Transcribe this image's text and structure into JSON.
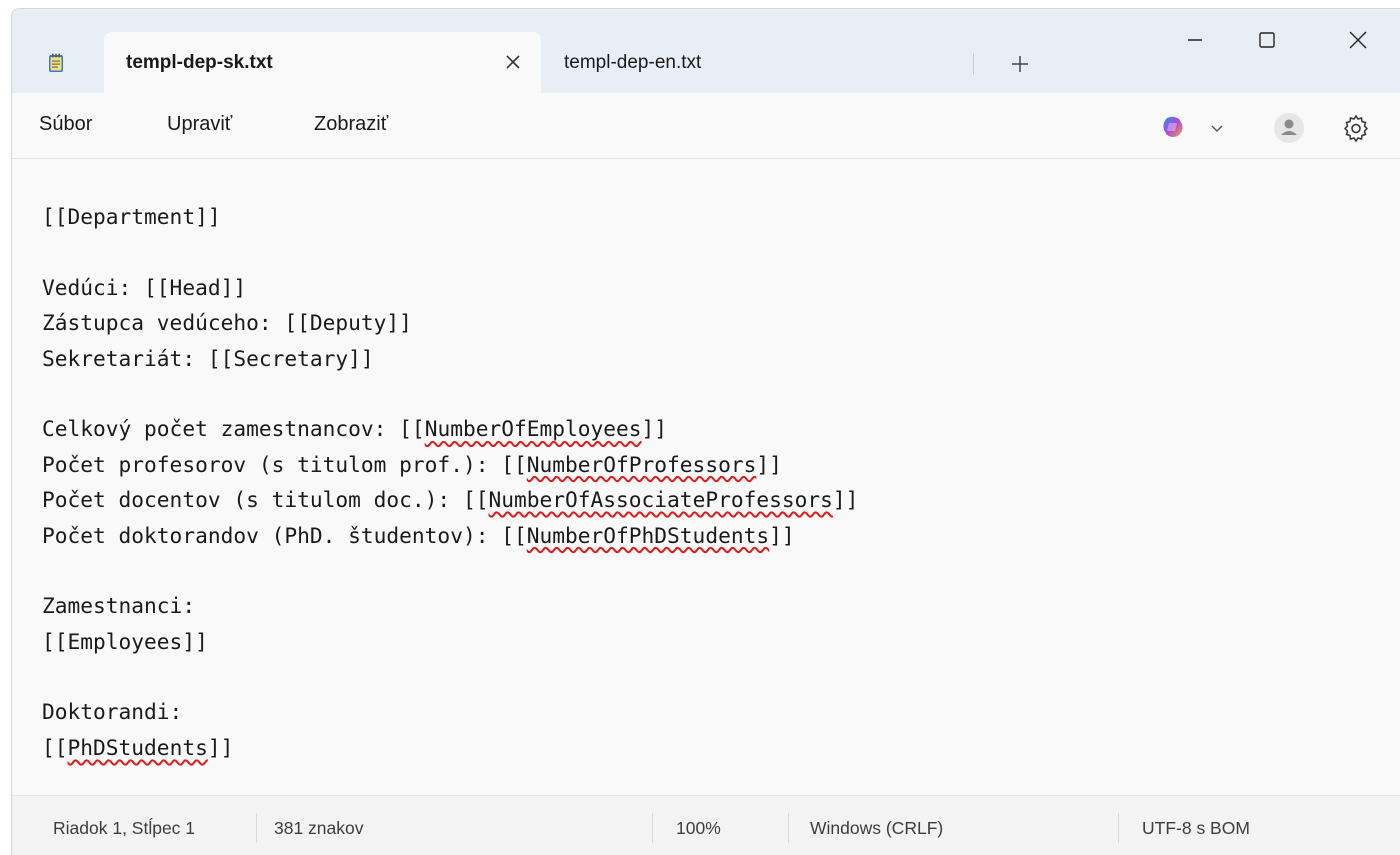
{
  "tabs": [
    {
      "label": "templ-dep-sk.txt",
      "active": true
    },
    {
      "label": "templ-dep-en.txt",
      "active": false
    }
  ],
  "menu": {
    "items": [
      "Súbor",
      "Upraviť",
      "Zobraziť"
    ]
  },
  "editor": {
    "lines": [
      [
        {
          "t": "[[Department]]"
        }
      ],
      [],
      [
        {
          "t": "Vedúci: [[Head]]"
        }
      ],
      [
        {
          "t": "Zástupca vedúceho: [[Deputy]]"
        }
      ],
      [
        {
          "t": "Sekretariát: [[Secretary]]"
        }
      ],
      [],
      [
        {
          "t": "Celkový počet zamestnancov: [["
        },
        {
          "t": "NumberOfEmployees",
          "s": true
        },
        {
          "t": "]]"
        }
      ],
      [
        {
          "t": "Počet profesorov (s titulom prof.): [["
        },
        {
          "t": "NumberOfProfessors",
          "s": true
        },
        {
          "t": "]]"
        }
      ],
      [
        {
          "t": "Počet docentov (s titulom doc.): [["
        },
        {
          "t": "NumberOfAssociateProfessors",
          "s": true
        },
        {
          "t": "]]"
        }
      ],
      [
        {
          "t": "Počet doktorandov (PhD. študentov): [["
        },
        {
          "t": "NumberOfPhDStudents",
          "s": true
        },
        {
          "t": "]]"
        }
      ],
      [],
      [
        {
          "t": "Zamestnanci:"
        }
      ],
      [
        {
          "t": "[[Employees]]"
        }
      ],
      [],
      [
        {
          "t": "Doktorandi:"
        }
      ],
      [
        {
          "t": "[["
        },
        {
          "t": "PhDStudents",
          "s": true
        },
        {
          "t": "]]"
        }
      ]
    ]
  },
  "status": {
    "position": "Riadok 1, Stĺpec 1",
    "chars": "381 znakov",
    "zoom": "100%",
    "line_ending": "Windows (CRLF)",
    "encoding": "UTF-8 s BOM"
  },
  "icons": {
    "app": "notepad-icon",
    "close_tab": "close-icon",
    "new_tab": "plus-icon",
    "minimize": "minimize-icon",
    "maximize": "maximize-icon",
    "close_window": "close-icon",
    "copilot": "copilot-icon",
    "dropdown": "chevron-down-icon",
    "account": "account-icon",
    "settings": "gear-icon"
  },
  "colors": {
    "titlebar": "#e8eef6",
    "editor_bg": "#f9f9f9",
    "spellcheck": "#e11b1b"
  }
}
